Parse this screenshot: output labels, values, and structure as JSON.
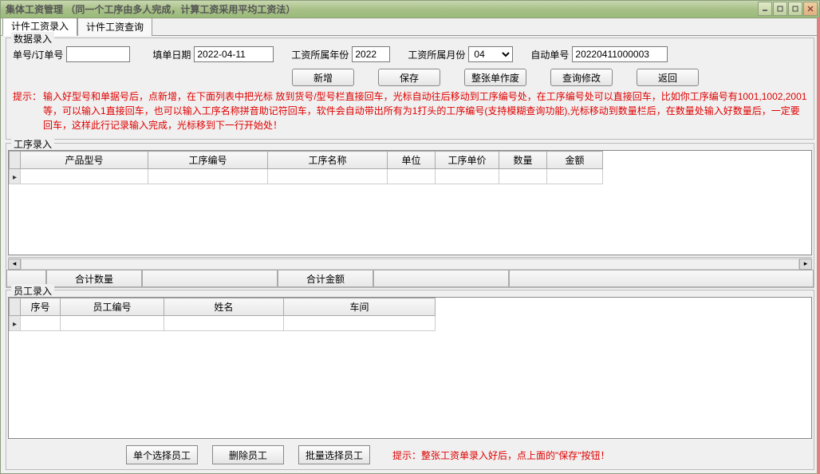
{
  "window": {
    "title": "集体工资管理 （同一个工序由多人完成，计算工资采用平均工资法）"
  },
  "tabs": {
    "entry": "计件工资录入",
    "query": "计件工资查询"
  },
  "group_data_entry": {
    "title": "数据录入"
  },
  "form": {
    "order_no_label": "单号/订单号",
    "order_no_value": "",
    "fill_date_label": "填单日期",
    "fill_date_value": "2022-04-11",
    "wage_year_label": "工资所属年份",
    "wage_year_value": "2022",
    "wage_month_label": "工资所属月份",
    "wage_month_value": "04",
    "auto_no_label": "自动单号",
    "auto_no_value": "20220411000003"
  },
  "buttons": {
    "add": "新增",
    "save": "保存",
    "void": "整张单作废",
    "query_edit": "查询修改",
    "back": "返回"
  },
  "hint": {
    "label": "提示：",
    "body": "输入好型号和单据号后，点新增，在下面列表中把光标\n放到货号/型号栏直接回车，光标自动往后移动到工序编号处，在工序编号处可以直接回车，比如你工序编号有1001,1002,2001等，可以输入1直接回车，也可以输入工序名称拼音助记符回车，软件会自动带出所有为1打头的工序编号(支持模糊查询功能),光标移动到数量栏后，在数量处输入好数量后，一定要回车，这样此行记录输入完成，光标移到下一行开始处！"
  },
  "proc_grid": {
    "title": "工序录入",
    "headers": {
      "product_model": "产品型号",
      "proc_no": "工序编号",
      "proc_name": "工序名称",
      "unit": "单位",
      "unit_price": "工序单价",
      "qty": "数量",
      "amount": "金额"
    }
  },
  "summary": {
    "total_qty": "合计数量",
    "total_amount": "合计金额"
  },
  "emp_grid": {
    "title": "员工录入",
    "headers": {
      "seq": "序号",
      "emp_no": "员工编号",
      "name": "姓名",
      "workshop": "车间"
    }
  },
  "bottom": {
    "select_one": "单个选择员工",
    "delete_emp": "删除员工",
    "batch_select": "批量选择员工",
    "hint": "提示：整张工资单录入好后，点上面的\"保存\"按钮！"
  }
}
